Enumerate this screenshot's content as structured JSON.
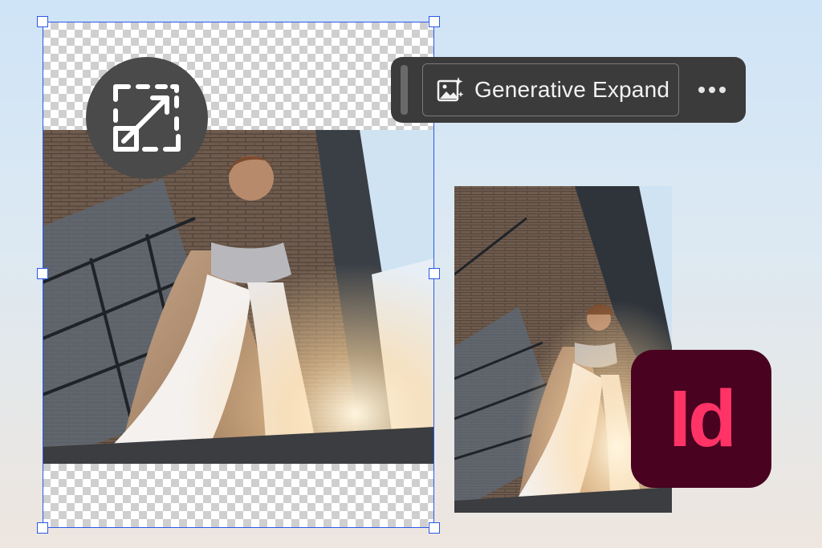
{
  "toolbar": {
    "generative_expand_label": "Generative Expand",
    "generative_expand_icon": "image-sparkle-icon",
    "more_icon": "more-options-icon"
  },
  "badge": {
    "icon": "expand-crop-icon"
  },
  "app_logo": {
    "text": "Id",
    "background": "#49021f",
    "color": "#ff3366"
  },
  "colors": {
    "selection": "#2a59e8",
    "toolbar_bg": "#3b3b3b",
    "badge_bg": "#4a4a4a"
  }
}
